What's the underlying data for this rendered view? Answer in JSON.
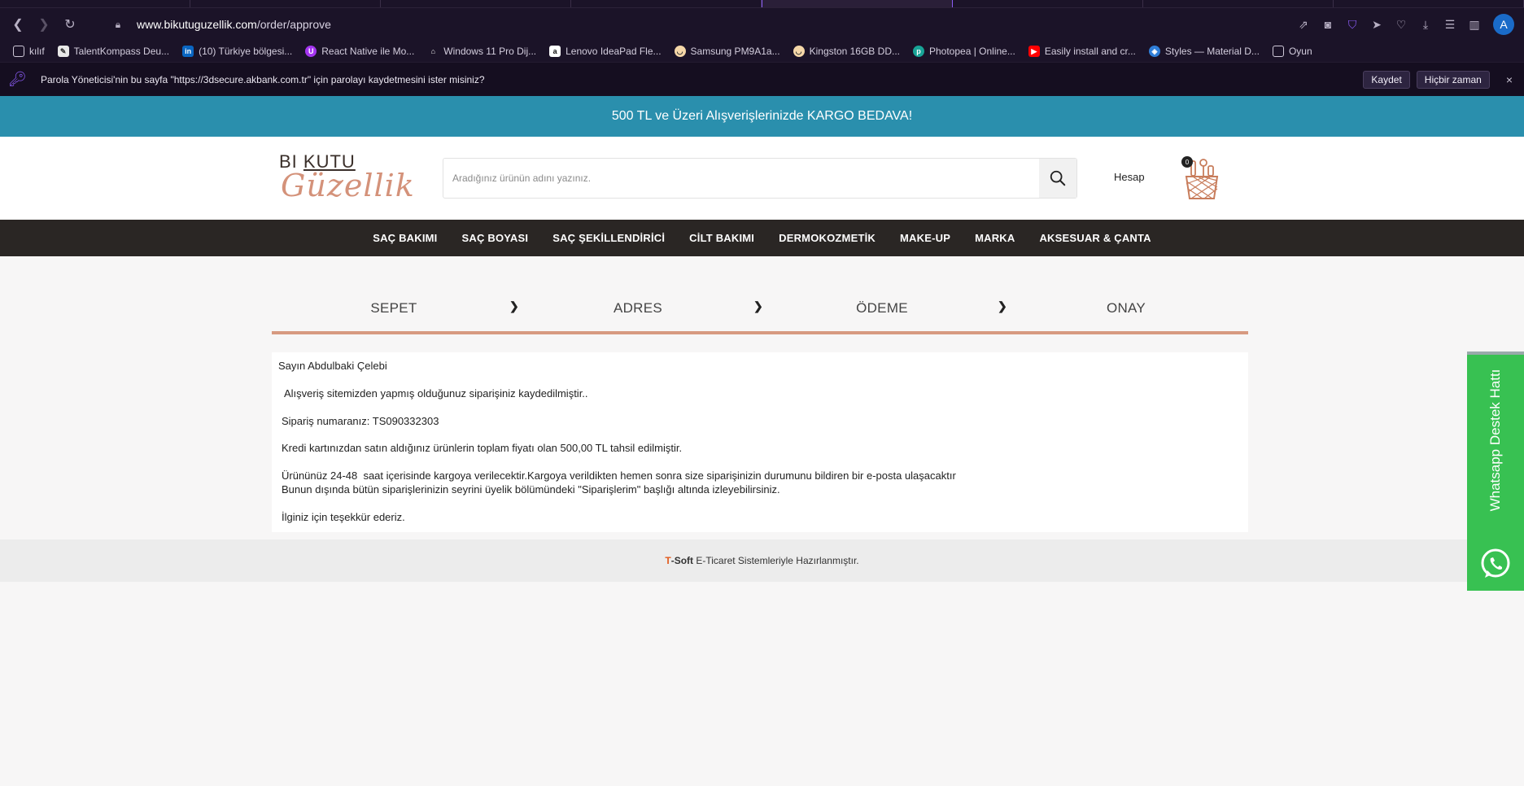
{
  "browser": {
    "url_host": "www.bikutuguzellik.com",
    "url_path": "/order/approve",
    "avatar_letter": "A"
  },
  "bookmarks": [
    {
      "label": "kılıf",
      "icon": "folder-icon"
    },
    {
      "label": "TalentKompass Deu...",
      "icon": "talentkompass-icon"
    },
    {
      "label": "(10) Türkiye bölgesi...",
      "icon": "linkedin-icon"
    },
    {
      "label": "React Native ile Mo...",
      "icon": "udemy-icon"
    },
    {
      "label": "Windows 11 Pro Dij...",
      "icon": "shop-icon"
    },
    {
      "label": "Lenovo IdeaPad Fle...",
      "icon": "amazon-icon"
    },
    {
      "label": "Samsung PM9A1a...",
      "icon": "shop-icon"
    },
    {
      "label": "Kingston 16GB DD...",
      "icon": "shop-icon"
    },
    {
      "label": "Photopea | Online...",
      "icon": "photopea-icon"
    },
    {
      "label": "Easily install and cr...",
      "icon": "youtube-icon"
    },
    {
      "label": "Styles — Material D...",
      "icon": "material-icon"
    },
    {
      "label": "Oyun",
      "icon": "folder-icon"
    }
  ],
  "password_bar": {
    "message": "Parola Yöneticisi'nin bu sayfa \"https://3dsecure.akbank.com.tr\" için parolayı kaydetmesini ister misiniz?",
    "save_label": "Kaydet",
    "never_label": "Hiçbir zaman",
    "close_label": "×"
  },
  "promo": {
    "text": "500 TL ve Üzeri Alışverişlerinizde KARGO BEDAVA!"
  },
  "header": {
    "logo_line1_a": "BI",
    "logo_line1_b": "KUTU",
    "logo_line2": "Güzellik",
    "search_placeholder": "Aradığınız ürünün adını yazınız.",
    "account_label": "Hesap",
    "cart_count": "0"
  },
  "categories": [
    "SAÇ BAKIMI",
    "SAÇ BOYASI",
    "SAÇ ŞEKİLLENDİRİCİ",
    "CİLT BAKIMI",
    "DERMOKOZMETİK",
    "MAKE-UP",
    "MARKA",
    "AKSESUAR & ÇANTA"
  ],
  "steps": [
    "SEPET",
    "ADRES",
    "ÖDEME",
    "ONAY"
  ],
  "step_separator": "❯",
  "confirmation": {
    "greeting": "Sayın Abdulbaki Çelebi",
    "line1": "Alışveriş sitemizden yapmış olduğunuz siparişiniz kaydedilmiştir..",
    "line2": "Sipariş numaranız: TS090332303",
    "line3": "Kredi kartınızdan satın aldığınız ürünlerin toplam fiyatı olan 500,00 TL tahsil edilmiştir.",
    "line4": "Ürününüz 24-48  saat içerisinde kargoya verilecektir.Kargoya verildikten hemen sonra size siparişinizin durumunu bildiren bir e-posta ulaşacaktır",
    "line5": "Bunun dışında bütün siparişlerinizin seyrini üyelik bölümündeki \"Siparişlerim\" başlığı altında izleyebilirsiniz.",
    "line6": "İlginiz için teşekkür ederiz."
  },
  "footer": {
    "t": "T",
    "soft": "-Soft",
    "rest": " E-Ticaret Sistemleriyle Hazırlanmıştır."
  },
  "whatsapp": {
    "label": "Whatsapp Destek Hattı"
  }
}
